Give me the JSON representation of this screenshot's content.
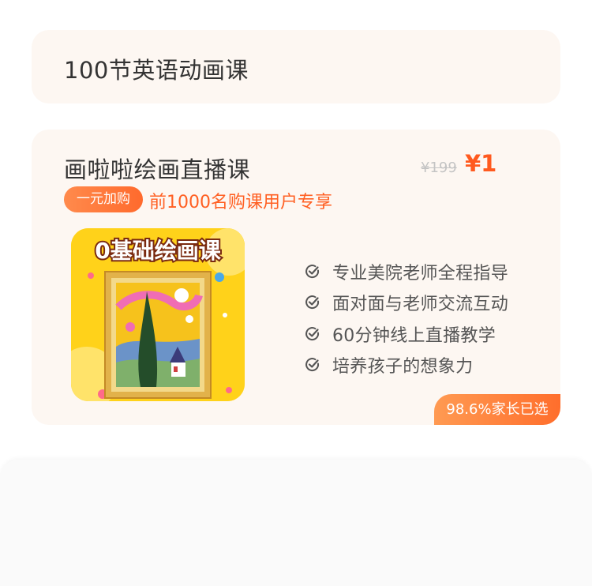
{
  "section1": {
    "title": "100节英语动画课"
  },
  "course": {
    "title": "画啦啦绘画直播课",
    "old_price": "¥199",
    "new_price": "¥1",
    "promo_badge": "一元加购",
    "promo_text": "前1000名购课用户专享",
    "cover_title": "0基础绘画课",
    "features": [
      "专业美院老师全程指导",
      "面对面与老师交流互动",
      "60分钟线上直播教学",
      "培养孩子的想象力"
    ],
    "selected_badge": "98.6%家长已选"
  },
  "colors": {
    "accent": "#ff5a1f",
    "card_bg": "#fdf7f2",
    "cover_bg": "#ffd21a"
  }
}
